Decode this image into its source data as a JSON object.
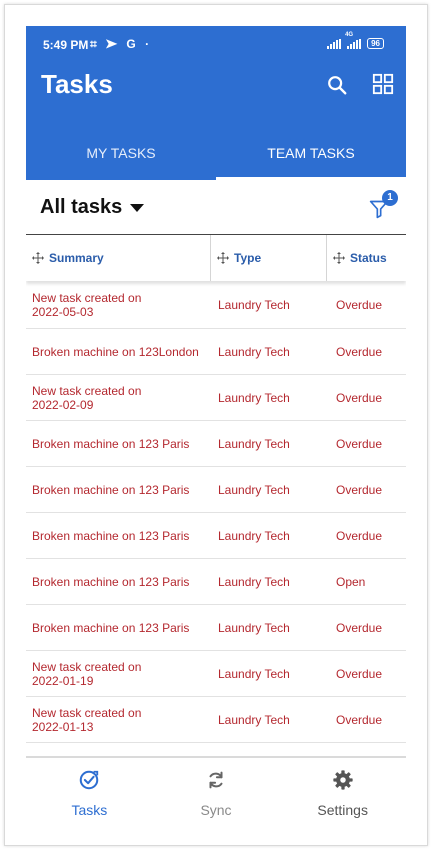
{
  "status_bar": {
    "time": "5:49 PM",
    "icons_text": "⌗ ➤ G ·",
    "network_label": "4G",
    "battery": "96"
  },
  "header": {
    "title": "Tasks"
  },
  "tabs": [
    {
      "label": "MY TASKS",
      "active": false
    },
    {
      "label": "TEAM TASKS",
      "active": true
    }
  ],
  "toolbar": {
    "filter_label": "All tasks",
    "filter_badge": "1"
  },
  "table": {
    "columns": [
      "Summary",
      "Type",
      "Status"
    ],
    "rows": [
      {
        "summary": "New task created on 2022-05-03",
        "type": "Laundry Tech",
        "status": "Overdue"
      },
      {
        "summary": "Broken machine on 123London",
        "type": "Laundry Tech",
        "status": "Overdue"
      },
      {
        "summary": "New task created on 2022-02-09",
        "type": "Laundry Tech",
        "status": "Overdue"
      },
      {
        "summary": "Broken machine on 123 Paris",
        "type": "Laundry Tech",
        "status": "Overdue"
      },
      {
        "summary": "Broken machine on 123 Paris",
        "type": "Laundry Tech",
        "status": "Overdue"
      },
      {
        "summary": "Broken machine on 123 Paris",
        "type": "Laundry Tech",
        "status": "Overdue"
      },
      {
        "summary": "Broken machine on 123 Paris",
        "type": "Laundry Tech",
        "status": "Open"
      },
      {
        "summary": "Broken machine on 123 Paris",
        "type": "Laundry Tech",
        "status": "Overdue"
      },
      {
        "summary": "New task created on 2022-01-19",
        "type": "Laundry Tech",
        "status": "Overdue"
      },
      {
        "summary": "New task created on 2022-01-13",
        "type": "Laundry Tech",
        "status": "Overdue"
      }
    ]
  },
  "bottom_nav": [
    {
      "label": "Tasks",
      "icon": "check-circle-icon",
      "active": true
    },
    {
      "label": "Sync",
      "icon": "sync-icon",
      "active": false
    },
    {
      "label": "Settings",
      "icon": "gear-icon",
      "active": false
    }
  ],
  "colors": {
    "primary": "#2d6ed1",
    "task_text": "#b4282f",
    "column_header": "#2a5caa",
    "nav_inactive": "#666666",
    "nav_active_label": "#2d6ed1"
  }
}
